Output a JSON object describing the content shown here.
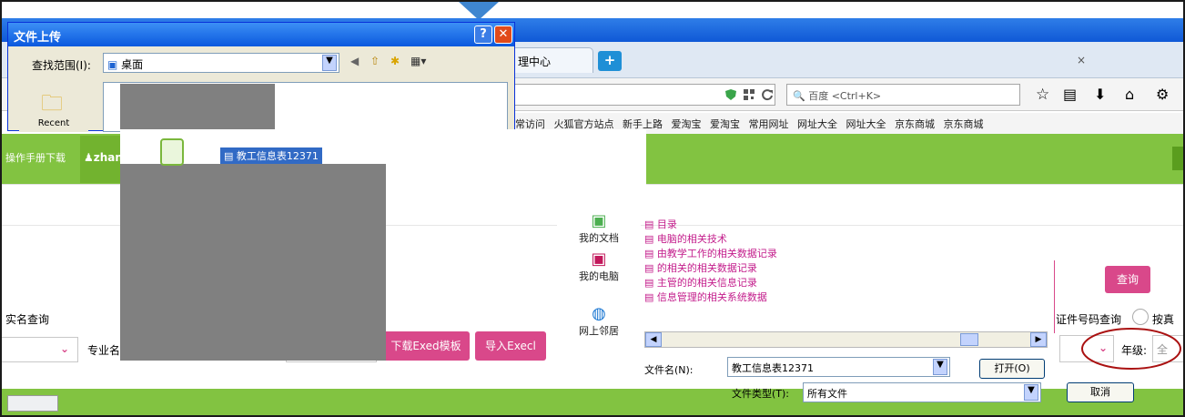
{
  "dialog": {
    "title": "文件上传",
    "help_label": "?",
    "close_label": "✕",
    "look_in_label": "查找范围(I):",
    "look_in_value": "桌面",
    "recent_label": "Recent",
    "selected_file": "教工信息表12371"
  },
  "browser": {
    "tab_label": "理中心",
    "tab_close": "×",
    "new_tab": "+",
    "search_placeholder": "百度 <Ctrl+K>",
    "bookmarks": [
      "常访问",
      "火狐官方站点",
      "新手上路",
      "爱淘宝",
      "爱淘宝",
      "常用网址",
      "网址大全",
      "网址大全",
      "京东商城",
      "京东商城"
    ]
  },
  "page": {
    "manual_link": "操作手册下载",
    "user": "zhan",
    "realname_query": "实名查询",
    "major_label": "专业名",
    "download_button": "下载Exed模板",
    "import_button": "导入Execl",
    "query_button": "查询",
    "id_query": "证件号码查询",
    "by_label": "按真",
    "grade_label": "年级:",
    "grade_value": "全"
  },
  "file_dialog": {
    "desktop_items": [
      "我的文档",
      "我的电脑",
      "网上邻居"
    ],
    "list_items": [
      "目录",
      "电脑的相关技术",
      "由教学工作的相关数据记录",
      "的相关的相关数据记录",
      "主管的的相关信息记录",
      "信息管理的相关系统数据"
    ],
    "filename_label": "文件名(N):",
    "filename_value": "教工信息表12371",
    "open_button": "打开(O)",
    "filetype_label": "文件类型(T):",
    "filetype_value": "所有文件",
    "cancel_button": "取消"
  },
  "colors": {
    "green": "#82c341",
    "pink": "#d9488a",
    "xp_blue": "#0b59de"
  }
}
